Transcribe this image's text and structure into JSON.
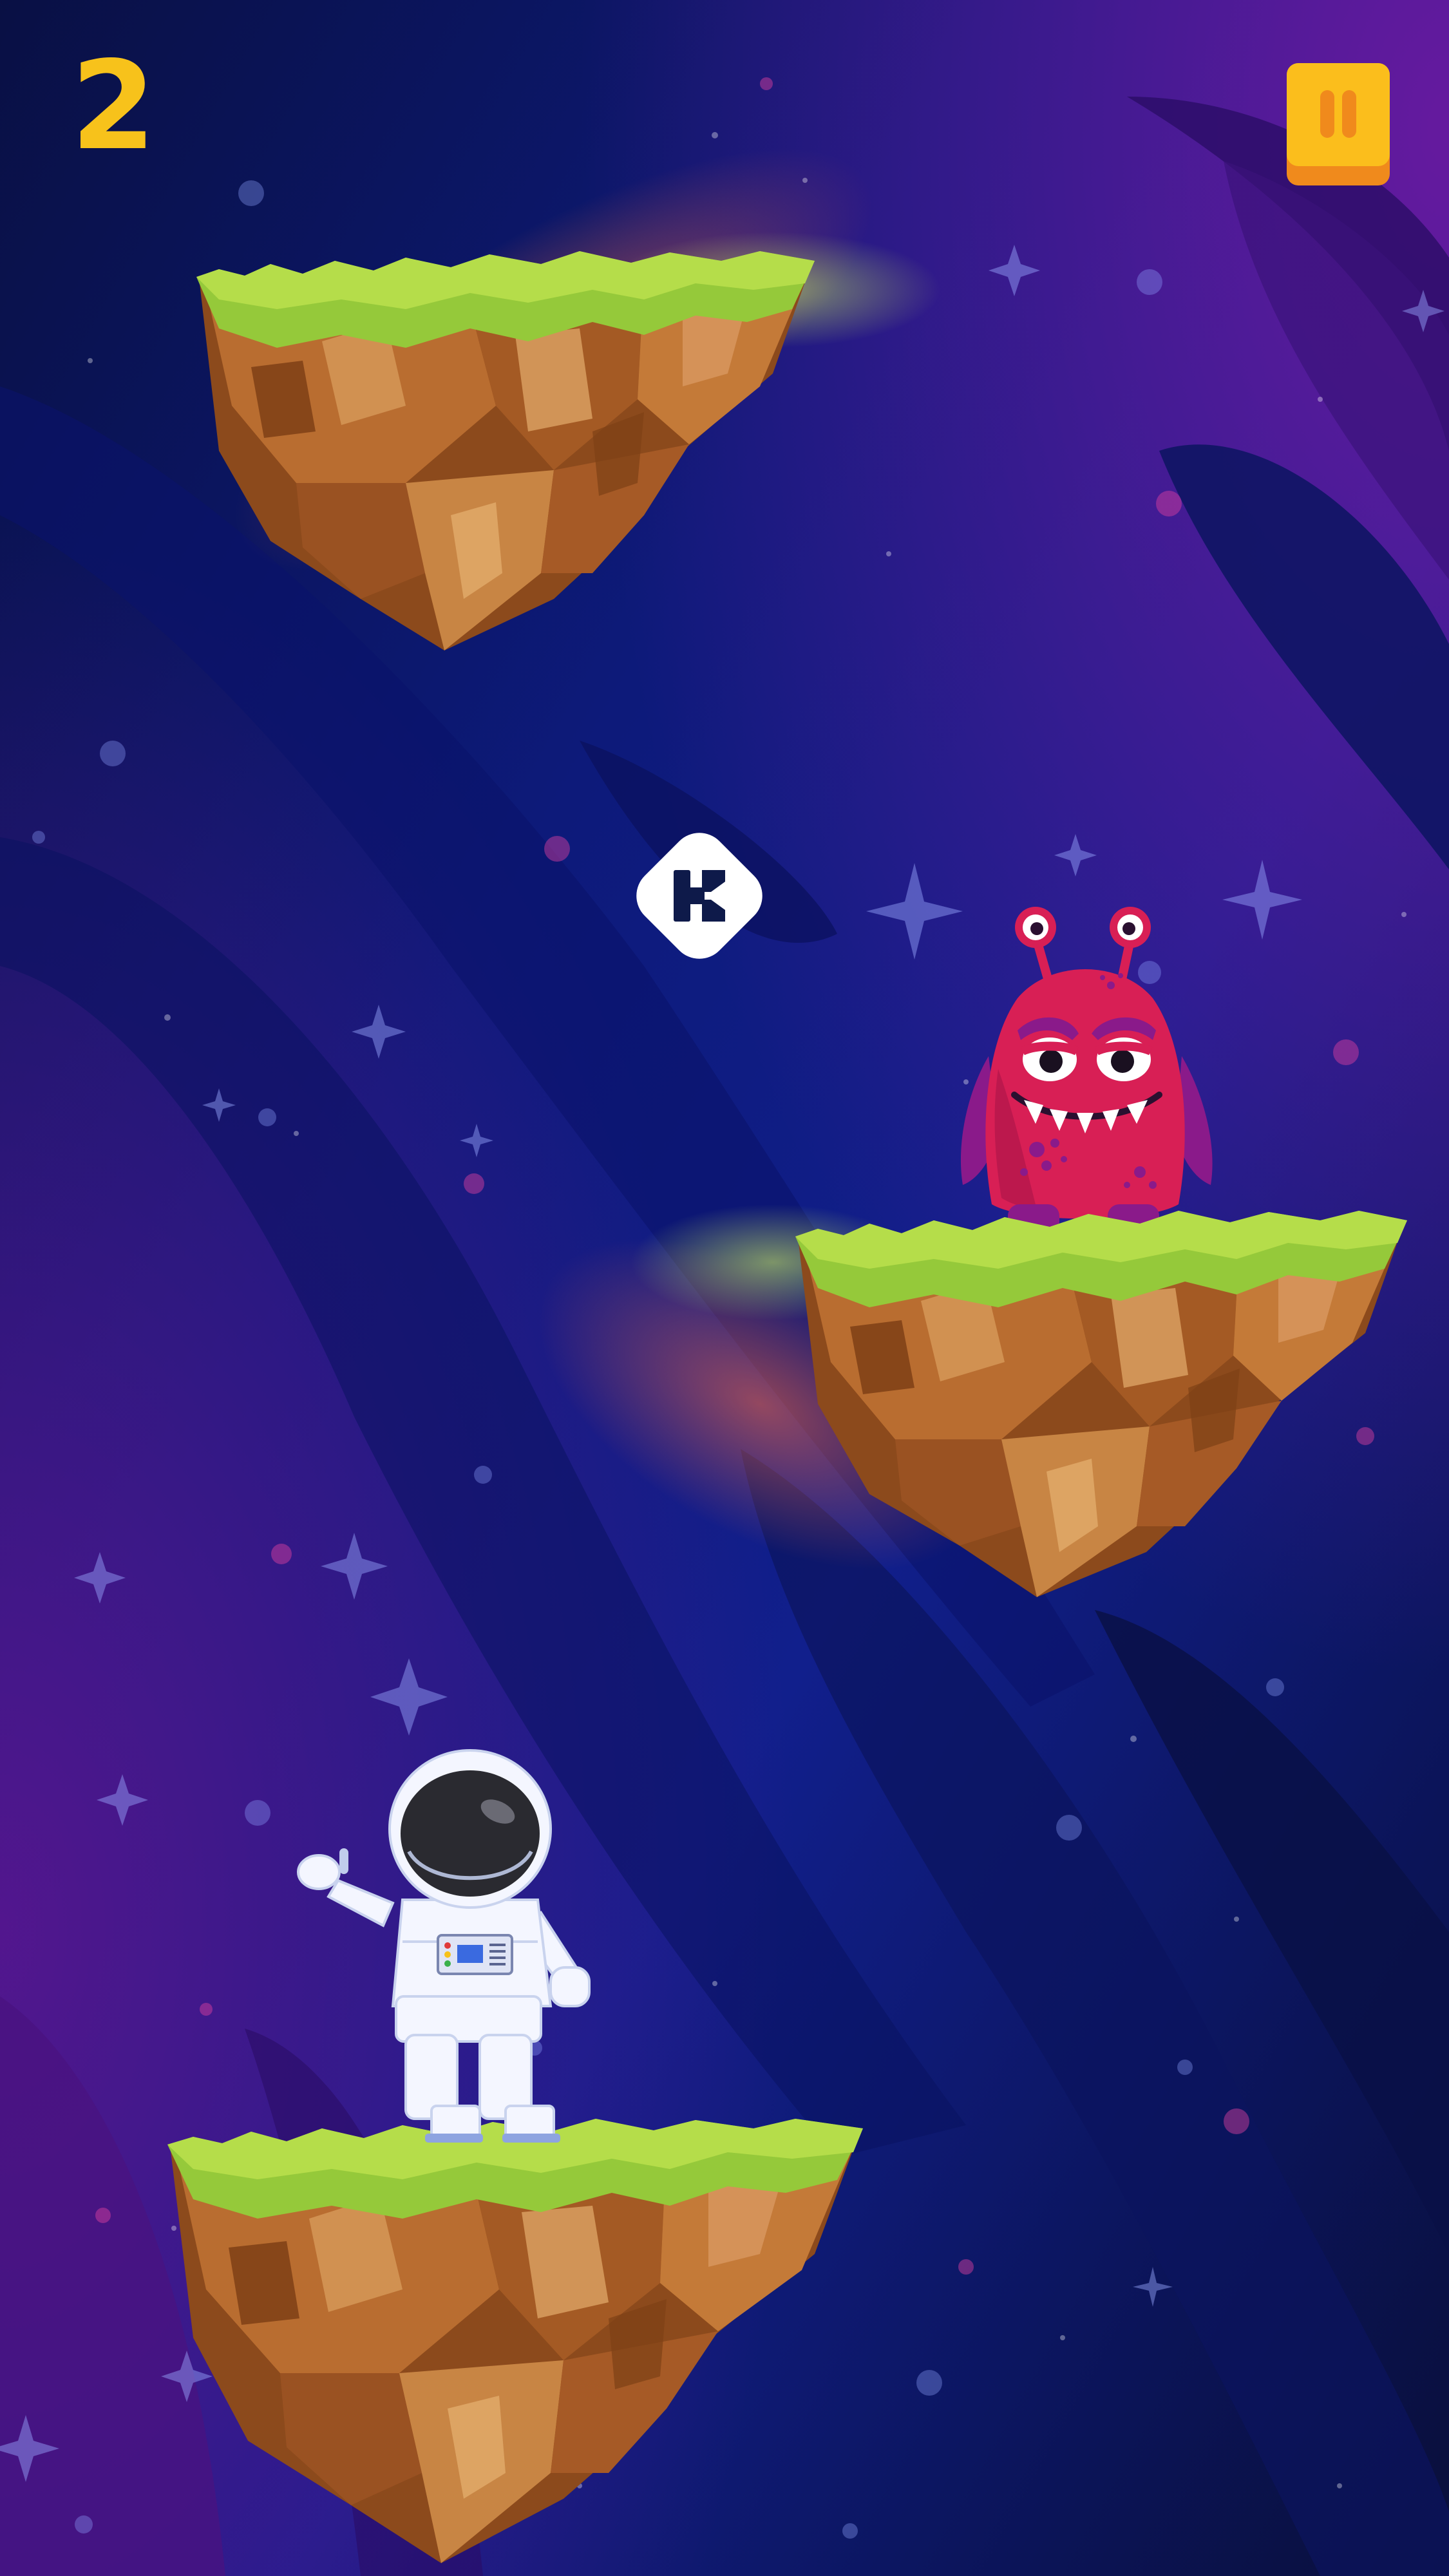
{
  "hud": {
    "score": "2",
    "score_color": "#f7c21b",
    "pause_icon": "pause-icon",
    "pause_color": "#fbbe1c"
  },
  "pickup": {
    "icon": "k-token-icon",
    "fill": "#ffffff",
    "glyph_color": "#0e1a4a"
  },
  "characters": {
    "player": "astronaut",
    "enemy": "red-three-eyed-alien"
  },
  "palette": {
    "space_dark": "#0a0f3a",
    "space_blue": "#1628a0",
    "space_purple": "#5a1690",
    "grass": "#9acc3a",
    "rock": "#b06a30",
    "alien": "#d81f55"
  }
}
